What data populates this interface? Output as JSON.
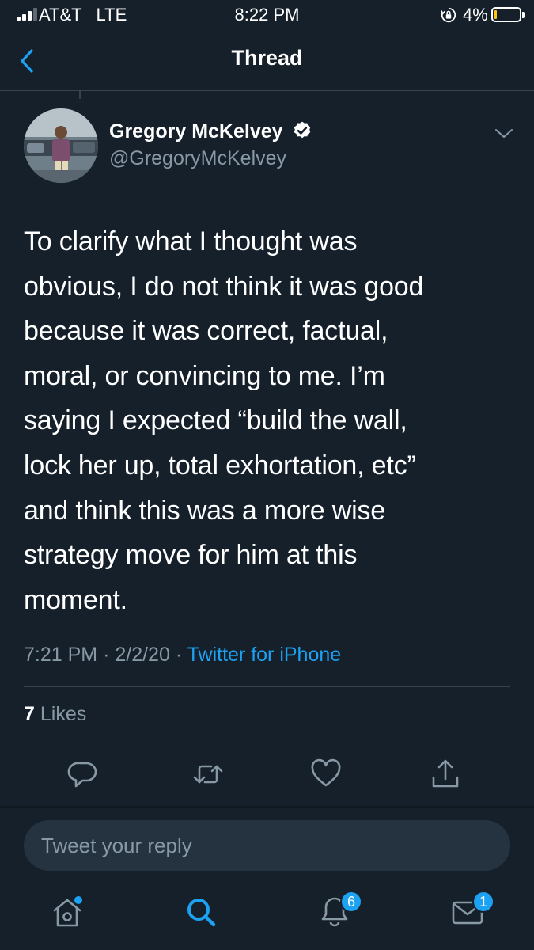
{
  "status_bar": {
    "carrier": "AT&T   LTE",
    "time": "8:22 PM",
    "battery_percent": "4%",
    "battery_level": 0.04,
    "icons": [
      "signal-icon",
      "orientation-lock-icon",
      "battery-icon"
    ]
  },
  "nav": {
    "title": "Thread",
    "back_icon": "chevron-left-icon"
  },
  "tweet": {
    "author": {
      "display_name": "Gregory McKelvey",
      "handle": "@GregoryMcKelvey",
      "verified": true
    },
    "text_lines": [
      "To clarify what I thought was",
      "obvious, I do not think it was good",
      "because it was correct, factual,",
      "moral, or convincing to me. I’m",
      "saying I expected “build the wall,",
      "lock her up, total exhortation, etc”",
      "and think this was a more wise",
      "strategy move for him at this",
      "moment."
    ],
    "time": "7:21 PM",
    "date": "2/2/20",
    "separator": "·",
    "source": "Twitter for iPhone",
    "likes_count": "7",
    "likes_label": "Likes"
  },
  "actions": [
    "reply-icon",
    "retweet-icon",
    "like-icon",
    "share-icon"
  ],
  "reply": {
    "placeholder": "Tweet your reply"
  },
  "tab_bar": {
    "tabs": [
      "home-icon",
      "search-icon",
      "notifications-icon",
      "messages-icon"
    ],
    "notifications_badge": "6",
    "messages_badge": "1"
  },
  "colors": {
    "background": "#15202b",
    "accent": "#1da1f2",
    "secondary_text": "#8899a6",
    "divider": "#38444d"
  }
}
